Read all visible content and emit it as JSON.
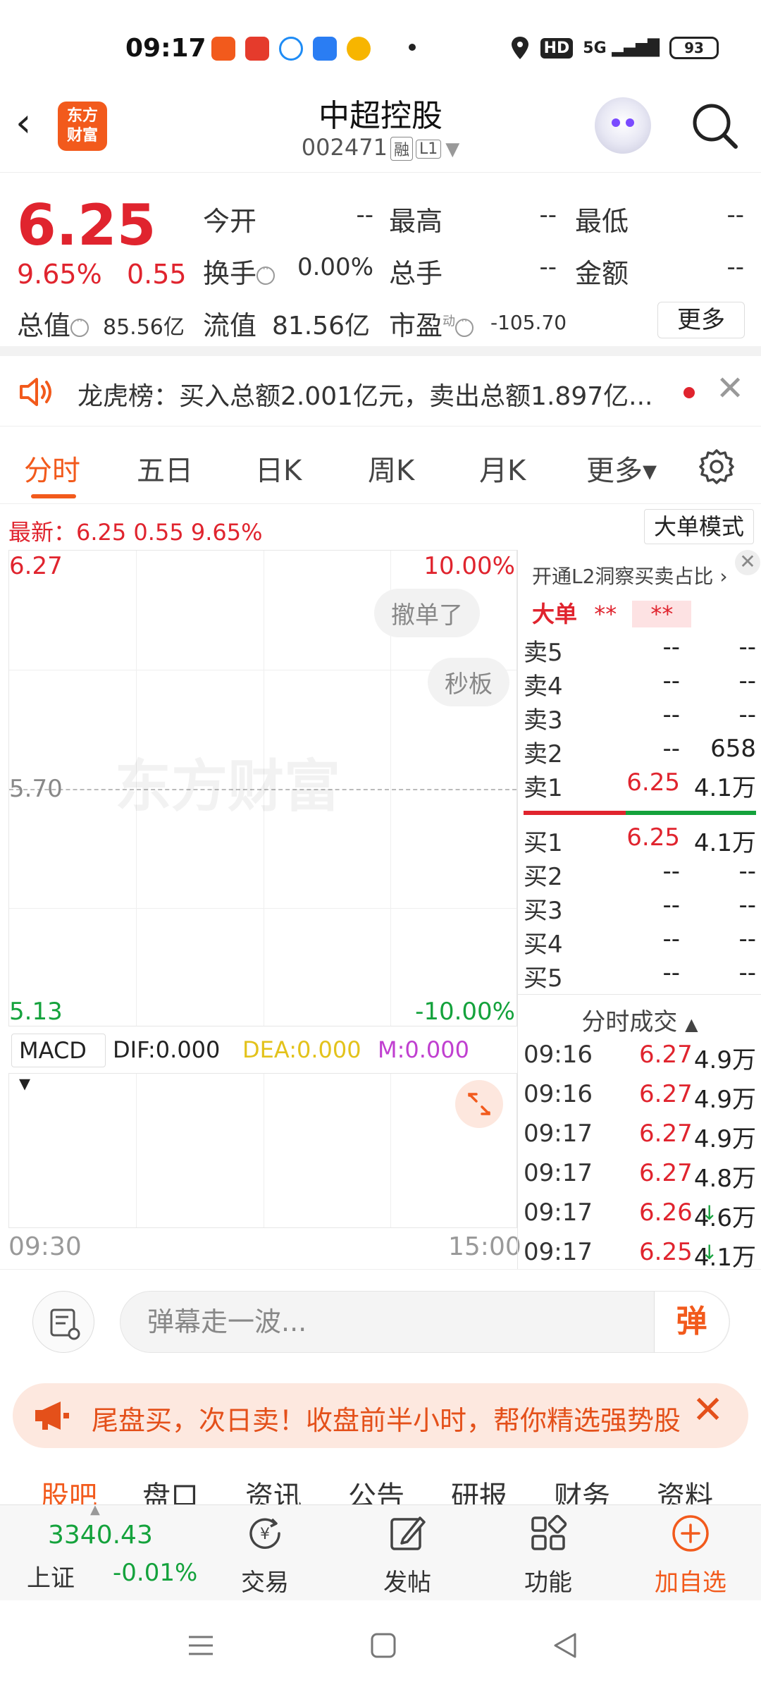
{
  "status_bar": {
    "time": "09:17",
    "network": "5G",
    "hd": "HD",
    "battery": "93"
  },
  "header": {
    "back_icon": "chevron-left-icon",
    "logo_text": [
      "东方",
      "财富"
    ],
    "stock_name": "中超控股",
    "stock_code": "002471",
    "tag_margin": "融",
    "tag_level": "L1",
    "search_icon": "search-icon"
  },
  "quote": {
    "price": "6.25",
    "change_pct": "9.65%",
    "change_abs": "0.55",
    "open_label": "今开",
    "open_value": "--",
    "high_label": "最高",
    "high_value": "--",
    "low_label": "最低",
    "low_value": "--",
    "turnover_label": "换手",
    "turnover_value": "0.00%",
    "volume_label": "总手",
    "volume_value": "--",
    "amount_label": "金额",
    "amount_value": "--",
    "mktcap_label": "总值",
    "mktcap_value": "85.56亿",
    "float_label": "流值",
    "float_value": "81.56亿",
    "pe_label": "市盈",
    "pe_sup": "动",
    "pe_value": "-105.70",
    "more_label": "更多"
  },
  "dragon_tiger": {
    "text": "龙虎榜：买入总额2.001亿元，卖出总额1.897亿..."
  },
  "tabs": [
    {
      "label": "分时"
    },
    {
      "label": "五日"
    },
    {
      "label": "日K"
    },
    {
      "label": "周K"
    },
    {
      "label": "月K"
    },
    {
      "label": "更多▾"
    }
  ],
  "latest": {
    "text": "最新：6.25  0.55  9.65%",
    "big_order_mode": "大单模式"
  },
  "chart": {
    "y_top": "6.27",
    "y_mid": "5.70",
    "y_bottom": "5.13",
    "pct_top": "10.00%",
    "pct_bottom": "-10.00%",
    "watermark": "东方财富",
    "bubble_cancel": "撤单了",
    "bubble_seconds": "秒板",
    "macd_select": "MACD ▾",
    "dif": "DIF:0.000",
    "dea": "DEA:0.000",
    "m": "M:0.000",
    "time_start": "09:30",
    "time_end": "15:00"
  },
  "order_book": {
    "l2_link": "开通L2洞察买卖占比 ›",
    "big_order_label": "大单",
    "big_order_val1": "**",
    "big_order_val2": "**",
    "asks": [
      {
        "label": "卖5",
        "price": "--",
        "qty": "--"
      },
      {
        "label": "卖4",
        "price": "--",
        "qty": "--"
      },
      {
        "label": "卖3",
        "price": "--",
        "qty": "--"
      },
      {
        "label": "卖2",
        "price": "--",
        "qty": "658"
      },
      {
        "label": "卖1",
        "price": "6.25",
        "qty": "4.1万"
      }
    ],
    "bids": [
      {
        "label": "买1",
        "price": "6.25",
        "qty": "4.1万"
      },
      {
        "label": "买2",
        "price": "--",
        "qty": "--"
      },
      {
        "label": "买3",
        "price": "--",
        "qty": "--"
      },
      {
        "label": "买4",
        "price": "--",
        "qty": "--"
      },
      {
        "label": "买5",
        "price": "--",
        "qty": "--"
      }
    ]
  },
  "ticks": {
    "title": "分时成交",
    "rows": [
      {
        "time": "09:16",
        "price": "6.27",
        "arrow": "",
        "vol": "4.9万"
      },
      {
        "time": "09:16",
        "price": "6.27",
        "arrow": "",
        "vol": "4.9万"
      },
      {
        "time": "09:17",
        "price": "6.27",
        "arrow": "",
        "vol": "4.9万"
      },
      {
        "time": "09:17",
        "price": "6.27",
        "arrow": "",
        "vol": "4.8万"
      },
      {
        "time": "09:17",
        "price": "6.26",
        "arrow": "↓",
        "vol": "4.6万"
      },
      {
        "time": "09:17",
        "price": "6.25",
        "arrow": "↓",
        "vol": "4.1万"
      }
    ]
  },
  "danmu": {
    "placeholder": "弹幕走一波...",
    "button": "弹"
  },
  "banner": {
    "text": "尾盘买，次日卖！收盘前半小时，帮你精选强势股"
  },
  "sub_tabs": [
    "股吧",
    "盘口",
    "资讯",
    "公告",
    "研报",
    "财务",
    "资料"
  ],
  "toolbar": {
    "index_value": "3340.43",
    "index_name": "上证",
    "index_change": "-0.01%",
    "trade": "交易",
    "post": "发帖",
    "functions": "功能",
    "add_watch": "加自选"
  },
  "colors": {
    "up": "#e0242e",
    "down": "#14a23c",
    "accent": "#f25a1c"
  }
}
